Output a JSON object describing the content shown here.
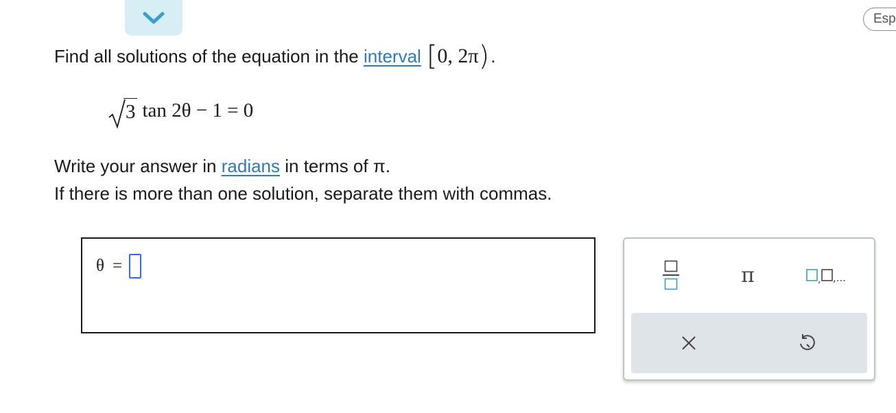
{
  "header": {
    "language_label": "Esp"
  },
  "problem": {
    "prompt_text": "Find all solutions of the equation in the",
    "interval_link": "interval",
    "interval_open": "[",
    "interval_value": "0, 2π",
    "interval_close": ")",
    "interval_period": ".",
    "equation": {
      "radicand": "3",
      "expression": "tan 2θ − 1 = 0"
    },
    "instruction_prefix": "Write your answer in",
    "radians_link": "radians",
    "instruction_suffix": "in terms of π.",
    "instruction_line2": "If there is more than one solution, separate them with commas."
  },
  "answer": {
    "variable": "θ",
    "equals": "=",
    "value": ""
  },
  "keypad": {
    "fraction_icon": "fraction-icon",
    "pi_label": "π",
    "list_icon": "list-icon",
    "list_suffix": ",...",
    "clear_icon": "close-icon",
    "undo_icon": "undo-icon"
  },
  "colors": {
    "link": "#2f7bb5",
    "accent_tab": "#d8eef5",
    "chevron": "#3a9fcf",
    "input_slot": "#3366ff",
    "keypad_icon": "#3a9fb5",
    "keypad_bottom": "#dfe4e8"
  }
}
